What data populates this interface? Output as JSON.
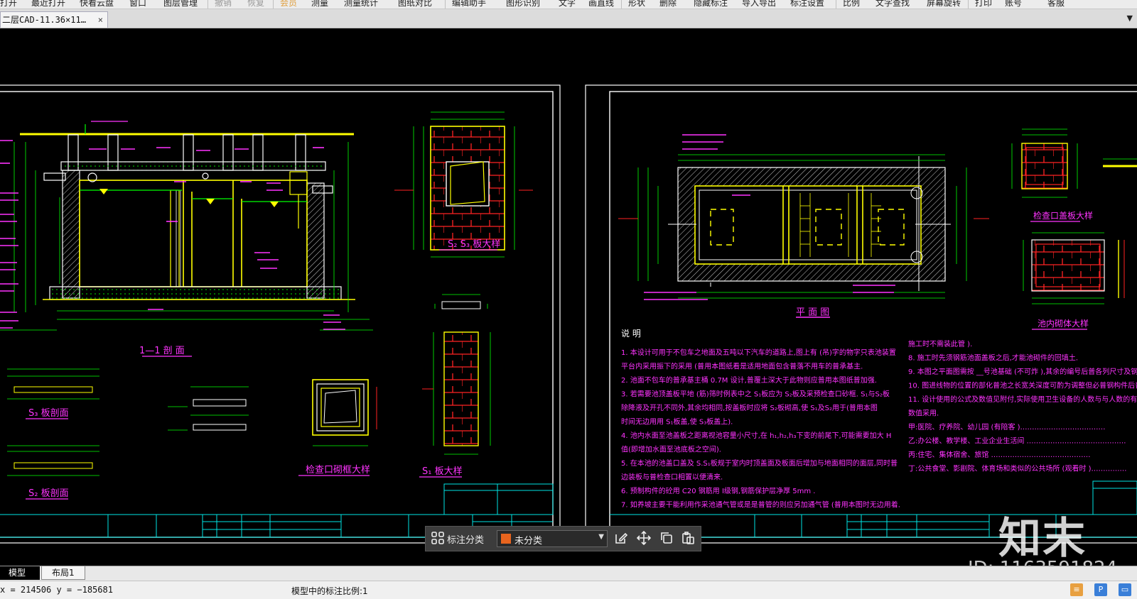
{
  "menu": {
    "items": [
      {
        "label": "打开",
        "state": "normal"
      },
      {
        "label": "最近打开",
        "state": "normal"
      },
      {
        "label": "快看云盘",
        "state": "normal"
      },
      {
        "label": "窗口",
        "state": "normal"
      },
      {
        "label": "图层管理",
        "state": "normal"
      },
      {
        "label": "撤销",
        "state": "disabled"
      },
      {
        "label": "恢复",
        "state": "disabled"
      },
      {
        "label": "会员",
        "state": "accent"
      },
      {
        "label": "测量",
        "state": "normal"
      },
      {
        "label": "测量统计",
        "state": "normal"
      },
      {
        "label": "图纸对比",
        "state": "normal"
      },
      {
        "label": "编辑助手",
        "state": "normal"
      },
      {
        "label": "图形识别",
        "state": "normal"
      },
      {
        "label": "文字",
        "state": "normal"
      },
      {
        "label": "画直线",
        "state": "normal"
      },
      {
        "label": "形状",
        "state": "normal"
      },
      {
        "label": "删除",
        "state": "normal"
      },
      {
        "label": "隐藏标注",
        "state": "normal"
      },
      {
        "label": "导入导出",
        "state": "normal"
      },
      {
        "label": "标注设置",
        "state": "normal"
      },
      {
        "label": "比例",
        "state": "normal"
      },
      {
        "label": "文字查找",
        "state": "normal"
      },
      {
        "label": "屏幕旋转",
        "state": "normal"
      },
      {
        "label": "打印",
        "state": "normal"
      },
      {
        "label": "账号",
        "state": "normal"
      },
      {
        "label": "客服",
        "state": "normal"
      }
    ]
  },
  "document_tab": {
    "title": "二层CAD-11.36×11…",
    "close": "×"
  },
  "tabbar_dropdown": "▼",
  "drawing": {
    "left_sheet": {
      "section_title": "1—1 剖 面",
      "s2s3_title": "S₂ S₃ 板大样",
      "s3_title": "S₃ 板剖面",
      "s2_title": "S₂ 板剖面",
      "s1_title": "S₁ 板大样",
      "frame_title": "检查口砌框大样"
    },
    "right_sheet": {
      "plan_title": "平 面 图",
      "cover_title": "检查口盖板大样",
      "tank_title": "池内砌体大样",
      "notes_heading": "说 明",
      "notes": [
        "1. 本设计可用于不包车之地面及五吨以下汽车的道路上,图上有           (吊)字的物字只表池装置",
        "   平台内采用振下的采用       (普用本图纸看是适用地面包含普落不用车的普承基主.",
        "2. 池面不包车的普承基主桶          0.7M  设计,普覆土深大于此物则应普用本图纸普加强.",
        "3. 若需要池顶盖板平地      (筋)筛时例表中之   S₁板应为   S₂板及采预检查口砂框.   S₁与S₂板",
        "   除降液及开孔不同外,其余均相同,按盖板时应将       S₂板砌高,使    S₁及S₂用于(普用本图",
        "   时间无边用用    S₁板盖,使    S₃板盖上).",
        "4. 池内水面至池盖板之距离视池容量小尺寸,在       h₁,h₂,h₃下变的前尾下,可能需要加大       H",
        "   值(即增加水面至池底板之空间).",
        "5. 在本池的池盖口盖及     S.S₁板规于室内时顶盖面及板面后增加与地面相同的面层,同时普",
        "   边装板与普检查口相置以便清来.",
        "6. 预制构件的砼用      C20   钢筋用  I级钢,钢筋保护层净厚       5mm   .",
        "7. 如养坡主要干能利用作采池通气管或是是普管的则应另加通气管             (普用本图时无边用着."
      ],
      "notes2": [
        "   施工时不需装此管       ).",
        "8. 施工时先须钢筋池面盖板之后,才能池砌件的回填土.",
        "9. 本图之平面图需按      __号池基础  (不可炸  ),其余的编号后普各列尺寸及钢筋所在地量普算.",
        "10.  图进线物的位置的部化普池之长宽关深度可酌为调整但必普钢构件后普各的用量普算.",
        "11.  设计使用的公式及数值见附付,实际使用卫生设备的人数与与人数的有分化可按下列",
        "     数值采用.",
        "  甲:医院、疗养院、幼儿园          (有陪客   )………………………………",
        "  乙:办公楼、教学楼、工业企业生活间          ……………………………………",
        "  丙:住宅、集体宿舍、旅馆          ……………………………………",
        "  丁:公共食堂、影剧院、体育场和类似的公共场所          (观看时   )……………"
      ]
    }
  },
  "float_toolbar": {
    "grid_icon": "grid-icon",
    "label": "标注分类",
    "select_value": "未分类",
    "select_color": "#e8641e",
    "select_arrow": "▼"
  },
  "layout_tabs": {
    "model": "模型",
    "layout1": "布局1"
  },
  "status": {
    "coords": "x = 214506  y = −185681",
    "scale_text": "模型中的标注比例:1"
  },
  "watermark": {
    "mark": "知末",
    "id": "ID: 1163591824"
  },
  "colors": {
    "cad_background": "#000000",
    "green": "#00ff00",
    "magenta": "#ff33ff",
    "yellow": "#ffff00",
    "cyan": "#00e5e5",
    "red": "#ff2222",
    "white": "#ffffff"
  }
}
